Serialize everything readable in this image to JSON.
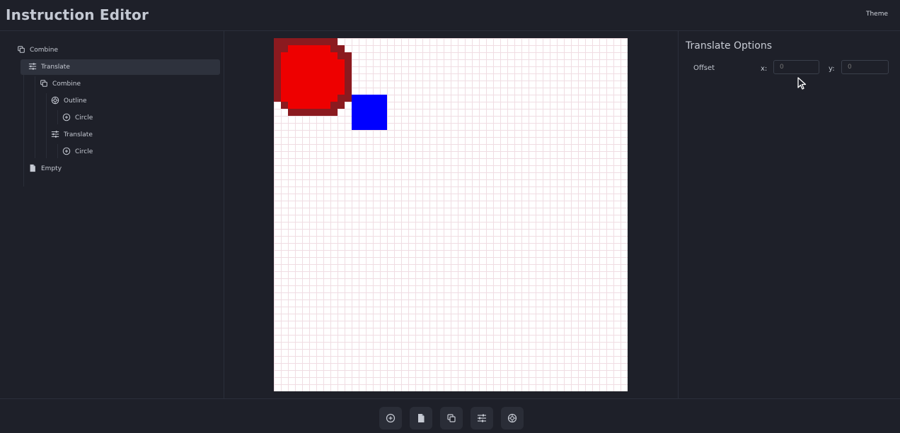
{
  "header": {
    "title": "Instruction Editor",
    "theme_label": "Theme"
  },
  "tree": [
    {
      "label": "Combine",
      "icon": "combine-icon",
      "depth": 0,
      "selected": false
    },
    {
      "label": "Translate",
      "icon": "sliders-icon",
      "depth": 1,
      "selected": true
    },
    {
      "label": "Combine",
      "icon": "combine-icon",
      "depth": 2,
      "selected": false
    },
    {
      "label": "Outline",
      "icon": "outline-icon",
      "depth": 3,
      "selected": false
    },
    {
      "label": "Circle",
      "icon": "circle-plus-icon",
      "depth": 4,
      "selected": false
    },
    {
      "label": "Translate",
      "icon": "sliders-icon",
      "depth": 3,
      "selected": false
    },
    {
      "label": "Circle",
      "icon": "circle-plus-icon",
      "depth": 4,
      "selected": false
    },
    {
      "label": "Empty",
      "icon": "file-icon",
      "depth": 1,
      "selected": false
    }
  ],
  "options": {
    "title": "Translate Options",
    "offset_label": "Offset",
    "x_label": "x:",
    "y_label": "y:",
    "x_placeholder": "0",
    "y_placeholder": "0"
  },
  "canvas": {
    "colors": {
      "outline": "#8b1a1f",
      "circle": "#ee0000",
      "square": "#0000ff",
      "grid": "#f0dde3"
    }
  },
  "toolbar": [
    {
      "icon": "circle-plus-icon",
      "name": "add-circle-button"
    },
    {
      "icon": "file-icon",
      "name": "add-empty-button"
    },
    {
      "icon": "combine-icon",
      "name": "add-combine-button"
    },
    {
      "icon": "sliders-icon",
      "name": "add-translate-button"
    },
    {
      "icon": "outline-icon",
      "name": "add-outline-button"
    }
  ]
}
